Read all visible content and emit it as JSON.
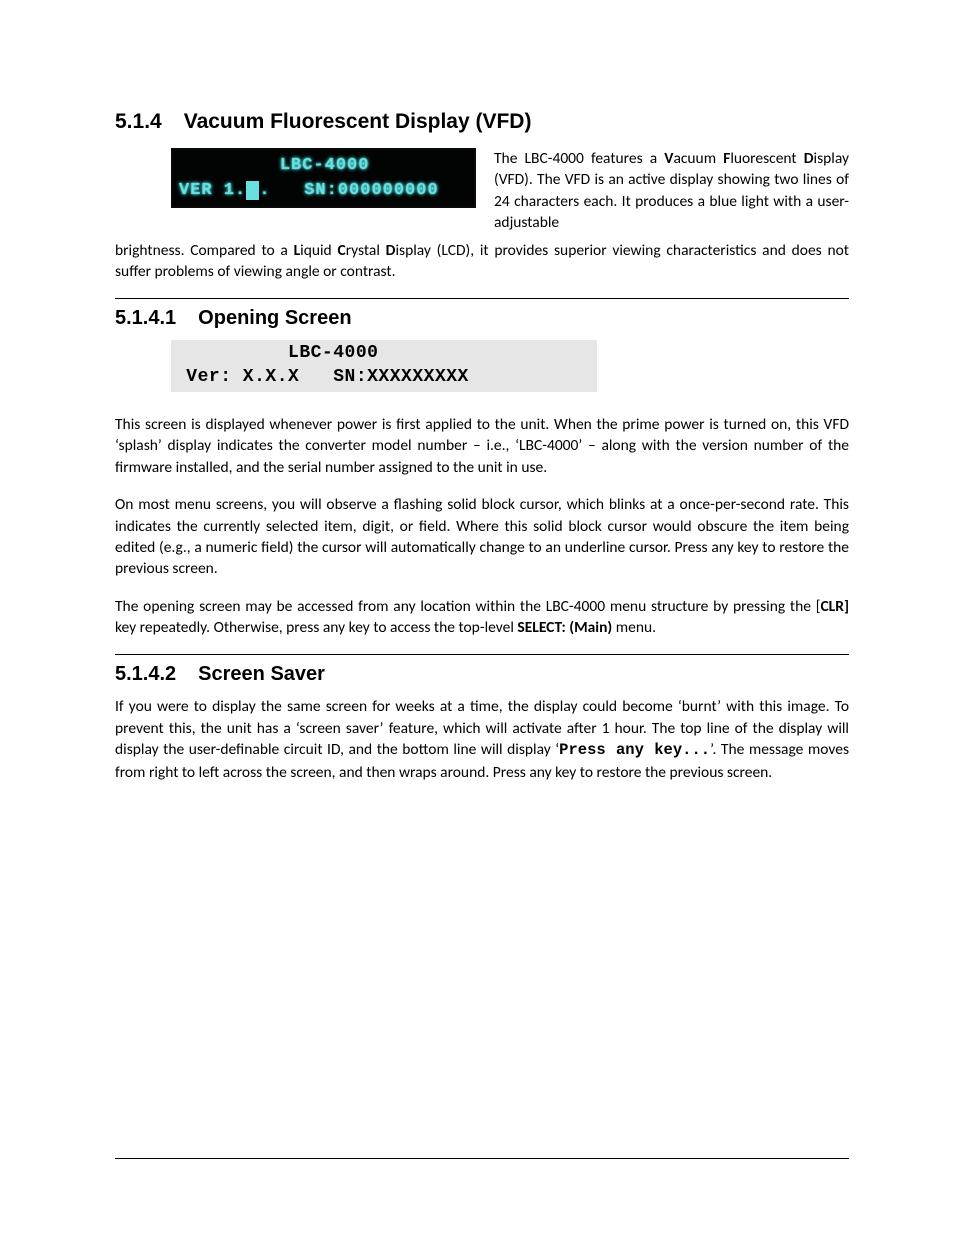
{
  "section_514": {
    "number": "5.1.4",
    "title": "Vacuum Fluorescent Display (VFD)"
  },
  "vfd_display": {
    "line1": "         LBC-4000       ",
    "line2_pre": "VER 1.",
    "line2_cursor": " ",
    "line2_post": ".   SN:000000000 "
  },
  "para_intro_side": "The LBC-4000 features a ",
  "para_intro_side2": "acuum ",
  "para_intro_side3": "luorescent ",
  "para_intro_side4": "isplay (VFD). The VFD is an active display showing two lines of 24 characters each. It produces a blue light with a user-adjustable",
  "para_intro_cont": "brightness. Compared to a ",
  "para_intro_cont2": "iquid ",
  "para_intro_cont3": "rystal ",
  "para_intro_cont4": "isplay (LCD), it provides superior viewing characteristics and does not suffer problems of viewing angle or contrast.",
  "section_5141": {
    "number": "5.1.4.1",
    "title": "Opening Screen"
  },
  "lcd_opening": {
    "line1": "          LBC-4000",
    "line2": " Ver: X.X.X   SN:XXXXXXXXX"
  },
  "para_open_1": "This screen is displayed whenever power is first applied to the unit. When the prime power is turned on, this VFD ‘splash’ display indicates the converter model number – i.e., ‘LBC-4000’ – along with the version number of the firmware installed, and the serial number assigned to the unit in use.",
  "para_open_2": "On most menu screens, you will observe a flashing solid block cursor, which blinks at a once-per-second rate. This indicates the currently selected item, digit, or field. Where this solid block cursor would obscure the item being edited (e.g., a numeric field) the cursor will automatically change to an underline cursor. Press any key to restore the previous screen.",
  "para_open_3a": "The opening screen may be accessed from any location within the LBC-4000 menu structure by pressing the [",
  "para_open_3_clr": "CLR]",
  "para_open_3b": " key repeatedly. Otherwise, press any key to access the top-level ",
  "para_open_3_select": "SELECT: (Main)",
  "para_open_3c": " menu.",
  "section_5142": {
    "number": "5.1.4.2",
    "title": "Screen Saver"
  },
  "para_ss_1a": "If you were to display the same screen for weeks at a time, the display could become ‘burnt’ with this image. To prevent this, the unit has a ‘screen saver’ feature, which will activate after 1 hour. The top line of the display will display the user-definable circuit ID, and the bottom line will display ‘",
  "para_ss_mono": "Press any key...",
  "para_ss_1b": "’. The message moves from right to left across the screen, and then wraps around. Press any key to restore the previous screen.",
  "bold_letters": {
    "V": "V",
    "F": "F",
    "D": "D",
    "L": "L",
    "C": "C"
  }
}
